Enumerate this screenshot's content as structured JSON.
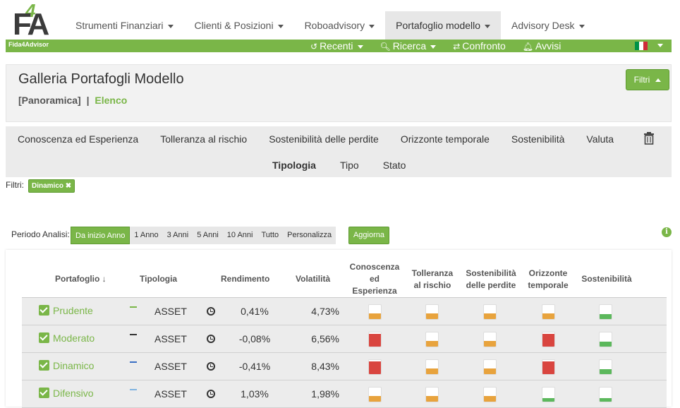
{
  "brand": {
    "logo_text": "F4A",
    "tagline": "Fida4Advisor"
  },
  "nav": {
    "items": [
      {
        "label": "Strumenti Finanziari",
        "active": false
      },
      {
        "label": "Clienti & Posizioni",
        "active": false
      },
      {
        "label": "Roboadvisory",
        "active": false
      },
      {
        "label": "Portafoglio modello",
        "active": true
      },
      {
        "label": "Advisory Desk",
        "active": false
      }
    ]
  },
  "subnav": {
    "recenti": "Recenti",
    "ricerca": "Ricerca",
    "confronto": "Confronto",
    "avvisi": "Avvisi",
    "flag_colors": [
      "#009246",
      "#ffffff",
      "#ce2b37"
    ]
  },
  "header": {
    "title": "Galleria Portafogli Modello",
    "view_panoramica": "[Panoramica]",
    "separator": "|",
    "view_elenco": "Elenco",
    "filtri_button": "Filtri"
  },
  "filters": {
    "row1": [
      "Conoscenza ed Esperienza",
      "Tolleranza al rischio",
      "Sostenibilità delle perdite",
      "Orizzonte temporale",
      "Sostenibilità",
      "Valuta"
    ],
    "row2": [
      "Tipologia",
      "Tipo",
      "Stato"
    ],
    "active_label": "Filtri:",
    "active_chip": "Dinamico ✖"
  },
  "period": {
    "label": "Periodo Analisi:",
    "options": [
      "Da inizio Anno",
      "1 Anno",
      "3 Anni",
      "5 Anni",
      "10 Anni",
      "Tutto",
      "Personalizza"
    ],
    "selected": "Da inizio Anno",
    "update_button": "Aggiorna"
  },
  "table": {
    "headers": {
      "portafoglio": "Portafoglio",
      "tipologia": "Tipologia",
      "rendimento": "Rendimento",
      "volatilita": "Volatilità",
      "conoscenza": "Conoscenza ed Esperienza",
      "tolleranza": "Tolleranza al rischio",
      "sostenibilita_perdite": "Sostenibilità delle perdite",
      "orizzonte": "Orizzonte temporale",
      "sostenibilita": "Sostenibilità"
    },
    "colors": {
      "orange": "#e8a33d",
      "red": "#d9453f",
      "green": "#5cb85c"
    },
    "rows": [
      {
        "name": "Prudente",
        "dash_color": "#7ab648",
        "tipologia": "ASSET",
        "rendimento": "0,41%",
        "volatilita": "4,73%",
        "indicators": [
          {
            "level": 0.4,
            "color": "orange"
          },
          {
            "level": 0.4,
            "color": "orange"
          },
          {
            "level": 0.4,
            "color": "orange"
          },
          {
            "level": 0.4,
            "color": "orange"
          },
          {
            "level": 0.35,
            "color": "green"
          }
        ]
      },
      {
        "name": "Moderato",
        "dash_color": "#333333",
        "tipologia": "ASSET",
        "rendimento": "-0,08%",
        "volatilita": "6,56%",
        "indicators": [
          {
            "level": 0.9,
            "color": "red"
          },
          {
            "level": 0.4,
            "color": "orange"
          },
          {
            "level": 0.4,
            "color": "orange"
          },
          {
            "level": 0.9,
            "color": "red"
          },
          {
            "level": 0.35,
            "color": "green"
          }
        ]
      },
      {
        "name": "Dinamico",
        "dash_color": "#3a6fc4",
        "tipologia": "ASSET",
        "rendimento": "-0,41%",
        "volatilita": "8,43%",
        "indicators": [
          {
            "level": 0.9,
            "color": "red"
          },
          {
            "level": 0.4,
            "color": "orange"
          },
          {
            "level": 0.4,
            "color": "orange"
          },
          {
            "level": 0.9,
            "color": "red"
          },
          {
            "level": 0.35,
            "color": "green"
          }
        ]
      },
      {
        "name": "Difensivo",
        "dash_color": "#7fb3e0",
        "tipologia": "ASSET",
        "rendimento": "1,03%",
        "volatilita": "1,98%",
        "indicators": [
          {
            "level": 0.4,
            "color": "orange"
          },
          {
            "level": 0.4,
            "color": "orange"
          },
          {
            "level": 0.4,
            "color": "orange"
          },
          {
            "level": 0.25,
            "color": "green"
          },
          {
            "level": 0.25,
            "color": "green"
          }
        ]
      }
    ]
  }
}
